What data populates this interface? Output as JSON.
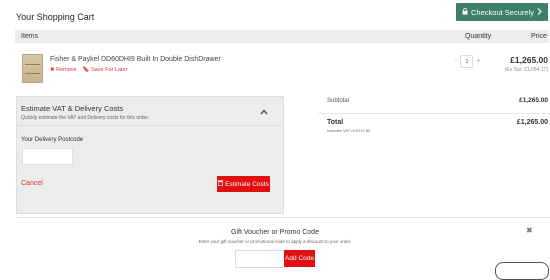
{
  "header": {
    "title": "Your Shopping Cart",
    "checkout_label": "Checkout Securely"
  },
  "table": {
    "col_items": "Items",
    "col_quantity": "Quantity",
    "col_price": "Price"
  },
  "product": {
    "name": "Fisher & Paykel DD60DHI9 Built In Double DishDrawer",
    "remove_label": "Remove",
    "save_label": "Save For Later",
    "quantity": "1",
    "price": "£1,265.00",
    "ex_tax": "(Ex Tax: £1,054.17)"
  },
  "vat": {
    "title": "Estimate VAT & Delivery Costs",
    "subtitle": "Quickly estimate the VAT and Delivery costs for this order.",
    "postcode_label": "Your Delivery Postcode",
    "cancel_label": "Cancel",
    "estimate_label": "Estimate Costs"
  },
  "summary": {
    "subtotal_label": "Subtotal",
    "subtotal_value": "£1,265.00",
    "total_label": "Total",
    "total_note": "Includes VAT of £210.83",
    "total_value": "£1,265.00"
  },
  "voucher": {
    "title": "Gift Voucher or Promo Code",
    "subtitle": "Enter your gift voucher or promotional code to apply a discount to your order.",
    "button_label": "Add Code"
  },
  "colors": {
    "accent_green": "#3e7f68",
    "accent_red": "#e01010"
  }
}
